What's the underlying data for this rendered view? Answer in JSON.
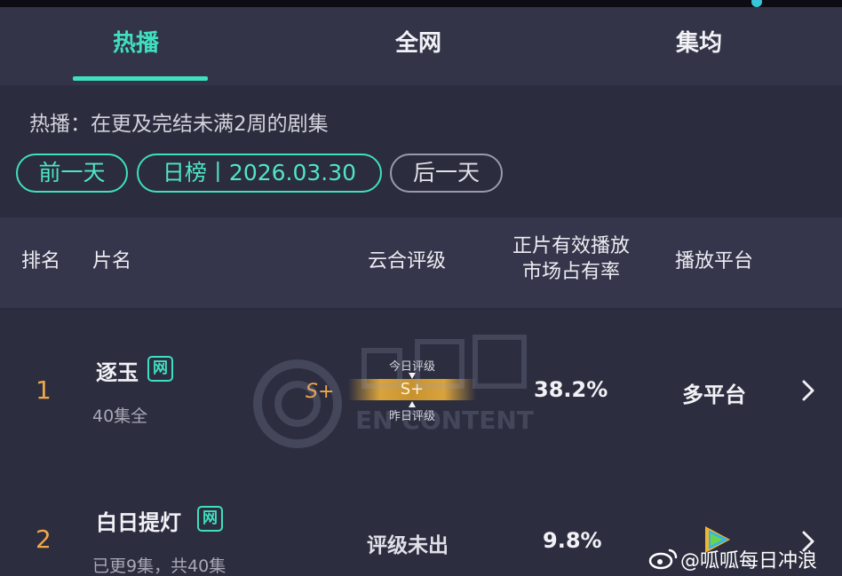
{
  "tabs": [
    {
      "label": "热播",
      "active": true
    },
    {
      "label": "全网",
      "active": false
    },
    {
      "label": "集均",
      "active": false
    }
  ],
  "description": "热播：在更及完结未满2周的剧集",
  "date_nav": {
    "prev_label": "前一天",
    "current_label": "日榜丨2026.03.30",
    "next_label": "后一天"
  },
  "table": {
    "headers": {
      "rank": "排名",
      "title": "片名",
      "rating": "云合评级",
      "share_line1": "正片有效播放",
      "share_line2": "市场占有率",
      "platform": "播放平台"
    },
    "rows": [
      {
        "rank": "1",
        "title": "逐玉",
        "badge": "网",
        "episodes": "40集全",
        "rating_prev": "S+",
        "rating_today_label": "今日评级",
        "rating_current": "S+",
        "rating_yesterday_label": "昨日评级",
        "share": "38.2%",
        "platform": "多平台"
      },
      {
        "rank": "2",
        "title": "白日提灯",
        "badge": "网",
        "episodes": "已更9集，共40集",
        "rating_status": "评级未出",
        "share": "9.8%",
        "platform_icon": "tencent-video-icon"
      }
    ]
  },
  "watermark_text": "EN CONTENT",
  "weibo_watermark": "@呱呱每日冲浪",
  "colors": {
    "accent": "#3fe0bf",
    "rank": "#f0a74a",
    "background": "#2b2c3e",
    "header_bg": "#35364b"
  }
}
